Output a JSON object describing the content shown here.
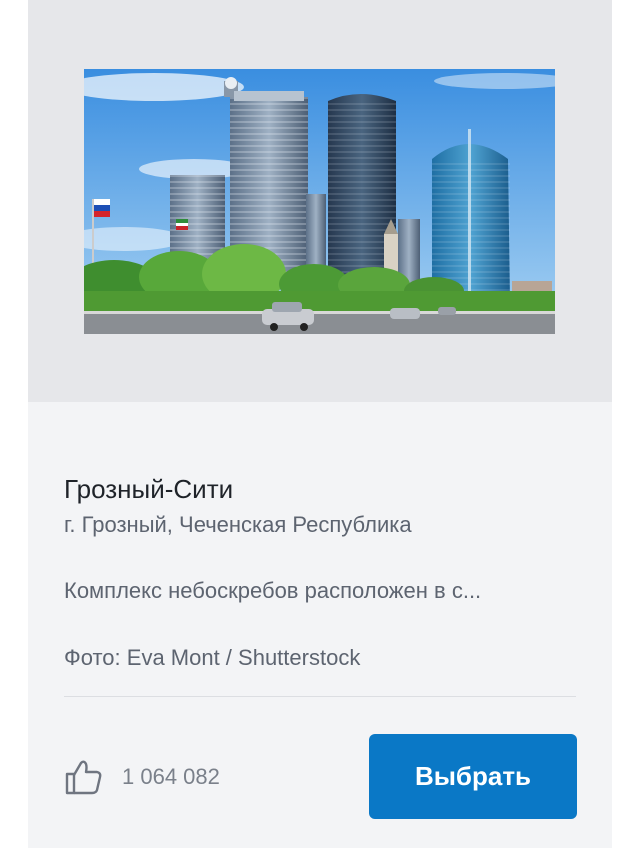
{
  "card": {
    "title": "Грозный-Сити",
    "location": "г. Грозный, Чеченская Республика",
    "description": "Комплекс небоскребов расположен в с...",
    "photo_credit": "Фото: Eva Mont / Shutterstock",
    "likes": {
      "icon": "thumbs-up-icon",
      "count": "1 064 082"
    },
    "choose_button_label": "Выбрать"
  },
  "colors": {
    "card_background": "#f3f4f6",
    "media_background": "#e6e7ea",
    "button": "#0a78c6",
    "button_text": "#ffffff",
    "title": "#1f2329",
    "secondary_text": "#5d6470"
  }
}
